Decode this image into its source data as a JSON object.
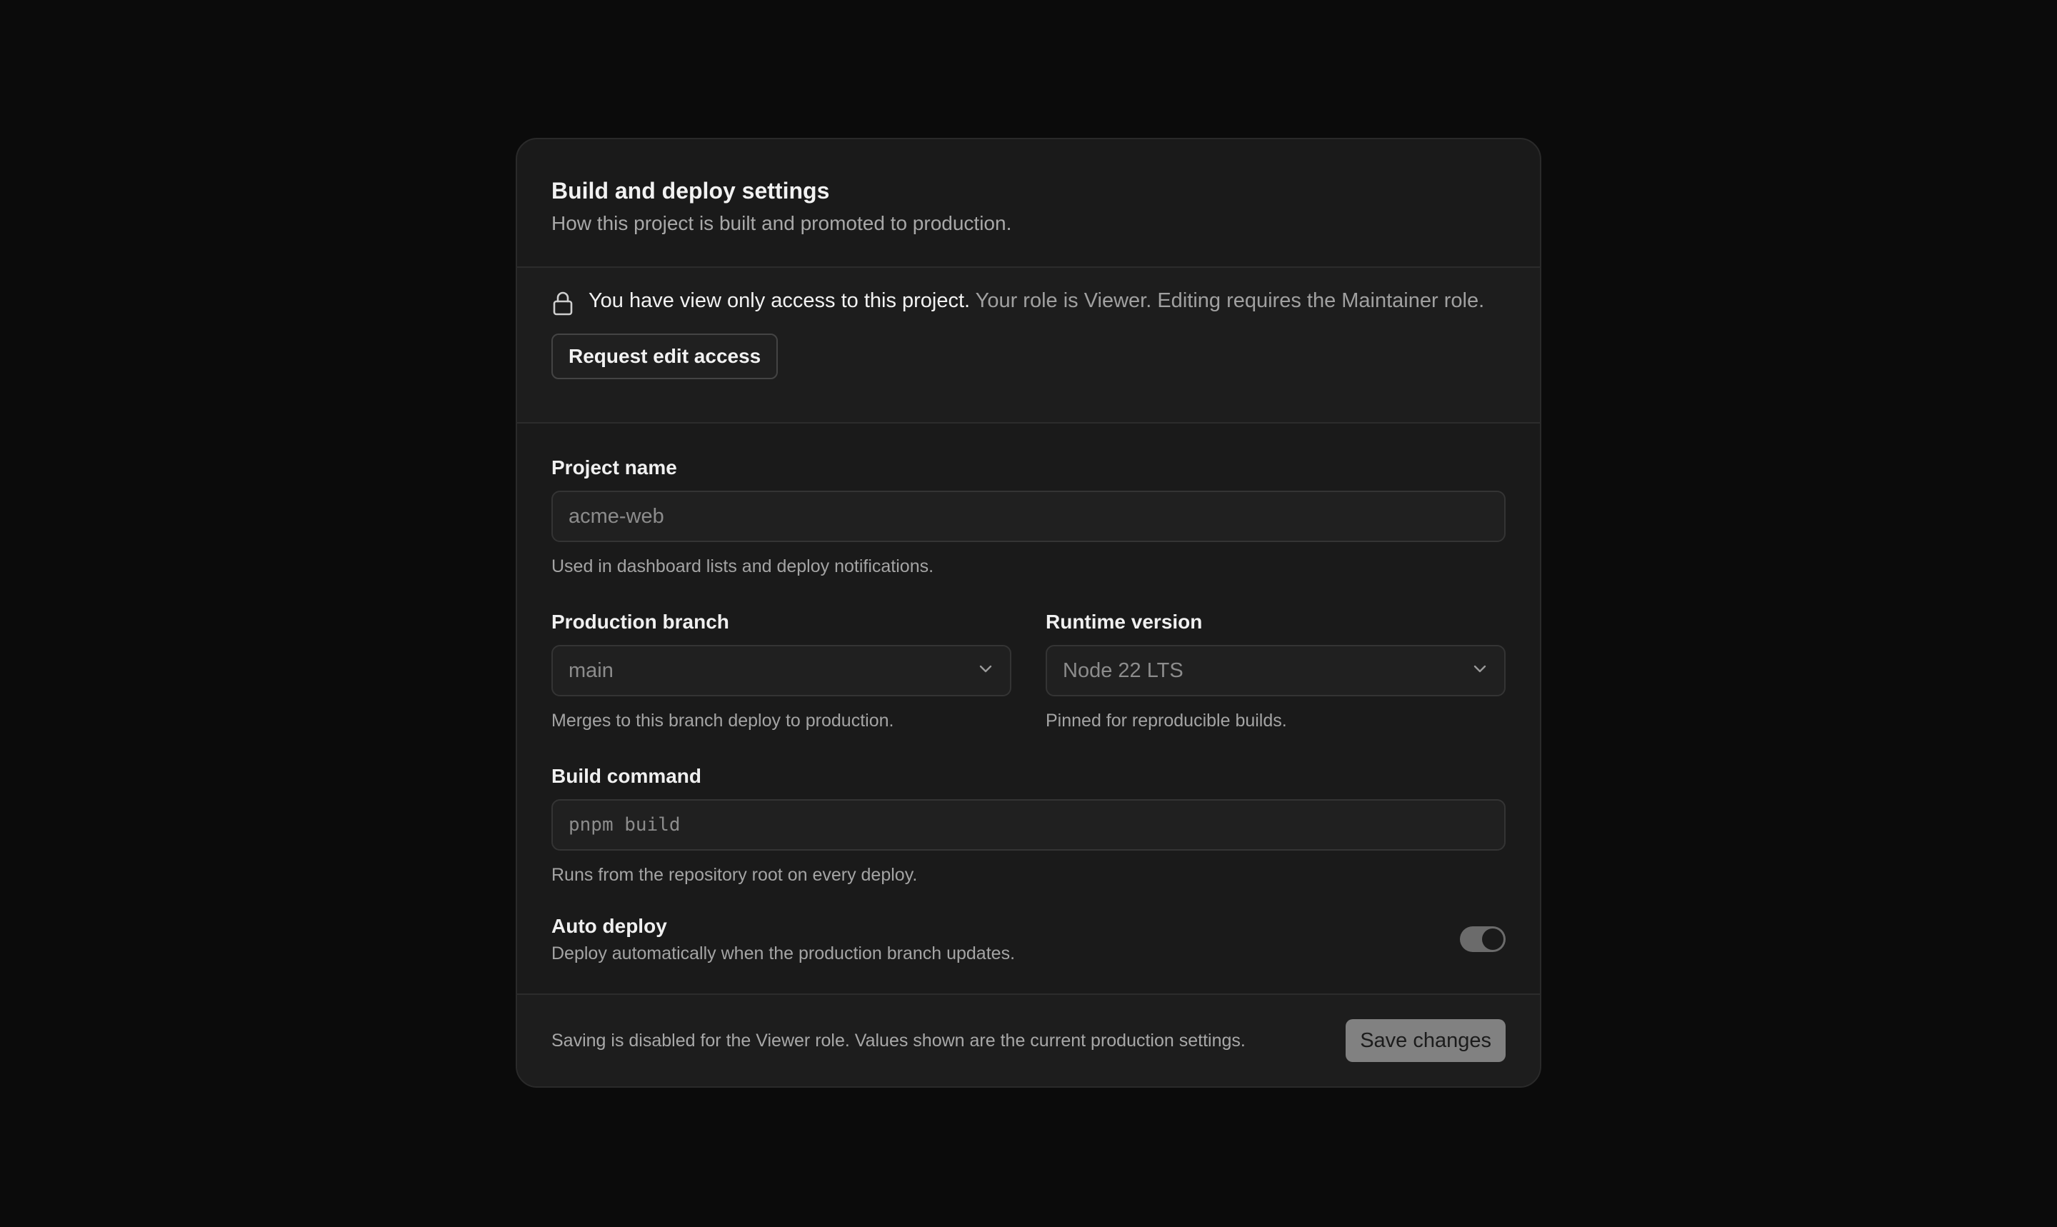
{
  "header": {
    "title": "Build and deploy settings",
    "subtitle": "How this project is built and promoted to production."
  },
  "notice": {
    "icon": "lock-icon",
    "strong": "You have view only access to this project.",
    "detail": " Your role is Viewer. Editing requires the Maintainer role.",
    "request_label": "Request edit access"
  },
  "form": {
    "project_name": {
      "label": "Project name",
      "value": "acme-web",
      "help": "Used in dashboard lists and deploy notifications."
    },
    "production_branch": {
      "label": "Production branch",
      "value": "main",
      "help": "Merges to this branch deploy to production."
    },
    "runtime_version": {
      "label": "Runtime version",
      "value": "Node 22 LTS",
      "help": "Pinned for reproducible builds."
    },
    "build_command": {
      "label": "Build command",
      "value": "pnpm build",
      "help": "Runs from the repository root on every deploy."
    },
    "auto_deploy": {
      "label": "Auto deploy",
      "description": "Deploy automatically when the production branch updates.",
      "enabled": true
    }
  },
  "footer": {
    "note": "Saving is disabled for the Viewer role. Values shown are the current production settings.",
    "save_label": "Save changes"
  }
}
